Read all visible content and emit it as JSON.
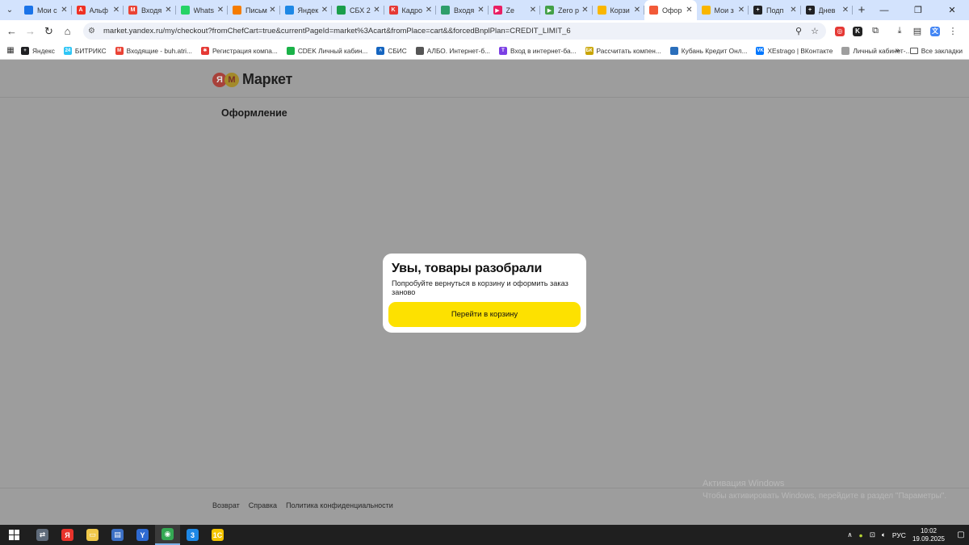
{
  "browser": {
    "tabs": [
      {
        "label": "Мои с",
        "icon": "cloud-icon",
        "color": "#1a73e8",
        "glyph": ""
      },
      {
        "label": "Альф",
        "icon": "alfa-icon",
        "color": "#ef3124",
        "glyph": "A"
      },
      {
        "label": "Входя",
        "icon": "gmail-icon",
        "color": "#ea4335",
        "glyph": "M"
      },
      {
        "label": "Whats",
        "icon": "whatsapp-icon",
        "color": "#25d366",
        "glyph": ""
      },
      {
        "label": "Письм",
        "icon": "mail-icon",
        "color": "#f57c00",
        "glyph": ""
      },
      {
        "label": "Яндек",
        "icon": "yandex-disk-icon",
        "color": "#1e88e5",
        "glyph": ""
      },
      {
        "label": "СБХ 2",
        "icon": "sheet-icon",
        "color": "#1b9e4b",
        "glyph": ""
      },
      {
        "label": "Кадро",
        "icon": "kadro-icon",
        "color": "#e53935",
        "glyph": "K"
      },
      {
        "label": "Входя",
        "icon": "doc-icon",
        "color": "#2e9e6a",
        "glyph": ""
      },
      {
        "label": "Ze",
        "icon": "youtube-icon",
        "color": "#e91e63",
        "glyph": "▶"
      },
      {
        "label": "Zero p",
        "icon": "play-icon",
        "color": "#43a047",
        "glyph": "▶"
      },
      {
        "label": "Корзи",
        "icon": "market-icon",
        "color": "#f9b600",
        "glyph": ""
      },
      {
        "label": "Офор",
        "icon": "market-icon",
        "color": "#f25a38",
        "glyph": "",
        "active": true
      },
      {
        "label": "Мои з",
        "icon": "market-icon",
        "color": "#f9b600",
        "glyph": ""
      },
      {
        "label": "Подп",
        "icon": "plus-icon",
        "color": "#202124",
        "glyph": "+"
      },
      {
        "label": "Днев",
        "icon": "plus-icon",
        "color": "#202124",
        "glyph": "+"
      }
    ],
    "url": "market.yandex.ru/my/checkout?fromChefCart=true&currentPageId=market%3Acart&fromPlace=cart&&forcedBnplPlan=CREDIT_LIMIT_6",
    "bookmarks": [
      {
        "label": "Яндекс",
        "color": "#202124",
        "glyph": "+"
      },
      {
        "label": "БИТРИКС",
        "color": "#2fc6f6",
        "glyph": "24"
      },
      {
        "label": "Входящие - buh.atri...",
        "color": "#ea4335",
        "glyph": "M"
      },
      {
        "label": "Регистрация компа...",
        "color": "#e53935",
        "glyph": "✱"
      },
      {
        "label": "CDEK Личный кабин...",
        "color": "#1ab248",
        "glyph": ""
      },
      {
        "label": "СБИС",
        "color": "#1565c0",
        "glyph": "˄"
      },
      {
        "label": "АЛБО. Интернет-б...",
        "color": "#555555",
        "glyph": ""
      },
      {
        "label": "Вход в интернет-ба...",
        "color": "#7b3fe4",
        "glyph": "T"
      },
      {
        "label": "Рассчитать компен...",
        "color": "#c9a400",
        "glyph": "БК"
      },
      {
        "label": "Кубань Кредит Онл...",
        "color": "#2a6ebb",
        "glyph": ""
      },
      {
        "label": "XEstrago | ВКонтакте",
        "color": "#0077ff",
        "glyph": "VK"
      },
      {
        "label": "Личный кабинет-...",
        "color": "#9e9e9e",
        "glyph": ""
      }
    ],
    "all_bookmarks": "Все закладки"
  },
  "page": {
    "logo_ya": "Я",
    "logo_m": "М",
    "logo_text": "Маркет",
    "title": "Оформление",
    "footer_links": [
      "Возврат",
      "Справка",
      "Политика конфиденциальности"
    ],
    "watermark_line1": "Активация Windows",
    "watermark_line2": "Чтобы активировать Windows, перейдите в раздел \"Параметры\"."
  },
  "modal": {
    "title": "Увы, товары разобрали",
    "text": "Попробуйте вернуться в корзину и оформить заказ заново",
    "button": "Перейти в корзину",
    "button_color": "#fde100"
  },
  "taskbar": {
    "apps": [
      {
        "name": "explorer-sync-icon",
        "color": "#5f6b7a",
        "glyph": "⇄"
      },
      {
        "name": "yandex-browser-icon",
        "color": "#e8332b",
        "glyph": "Я"
      },
      {
        "name": "file-explorer-icon",
        "color": "#f0c84a",
        "glyph": "▭"
      },
      {
        "name": "network-icon",
        "color": "#3b6fc4",
        "glyph": "▤"
      },
      {
        "name": "yandex-icon",
        "color": "#2e6ad1",
        "glyph": "Y"
      },
      {
        "name": "chrome-icon",
        "color": "#34a853",
        "glyph": "◉",
        "active": true
      },
      {
        "name": "mail-agent-icon",
        "color": "#1e88e5",
        "glyph": "3"
      },
      {
        "name": "1c-icon",
        "color": "#f4c400",
        "glyph": "1С"
      }
    ],
    "language": "РУС",
    "time": "10:02",
    "date": "19.09.2025"
  }
}
